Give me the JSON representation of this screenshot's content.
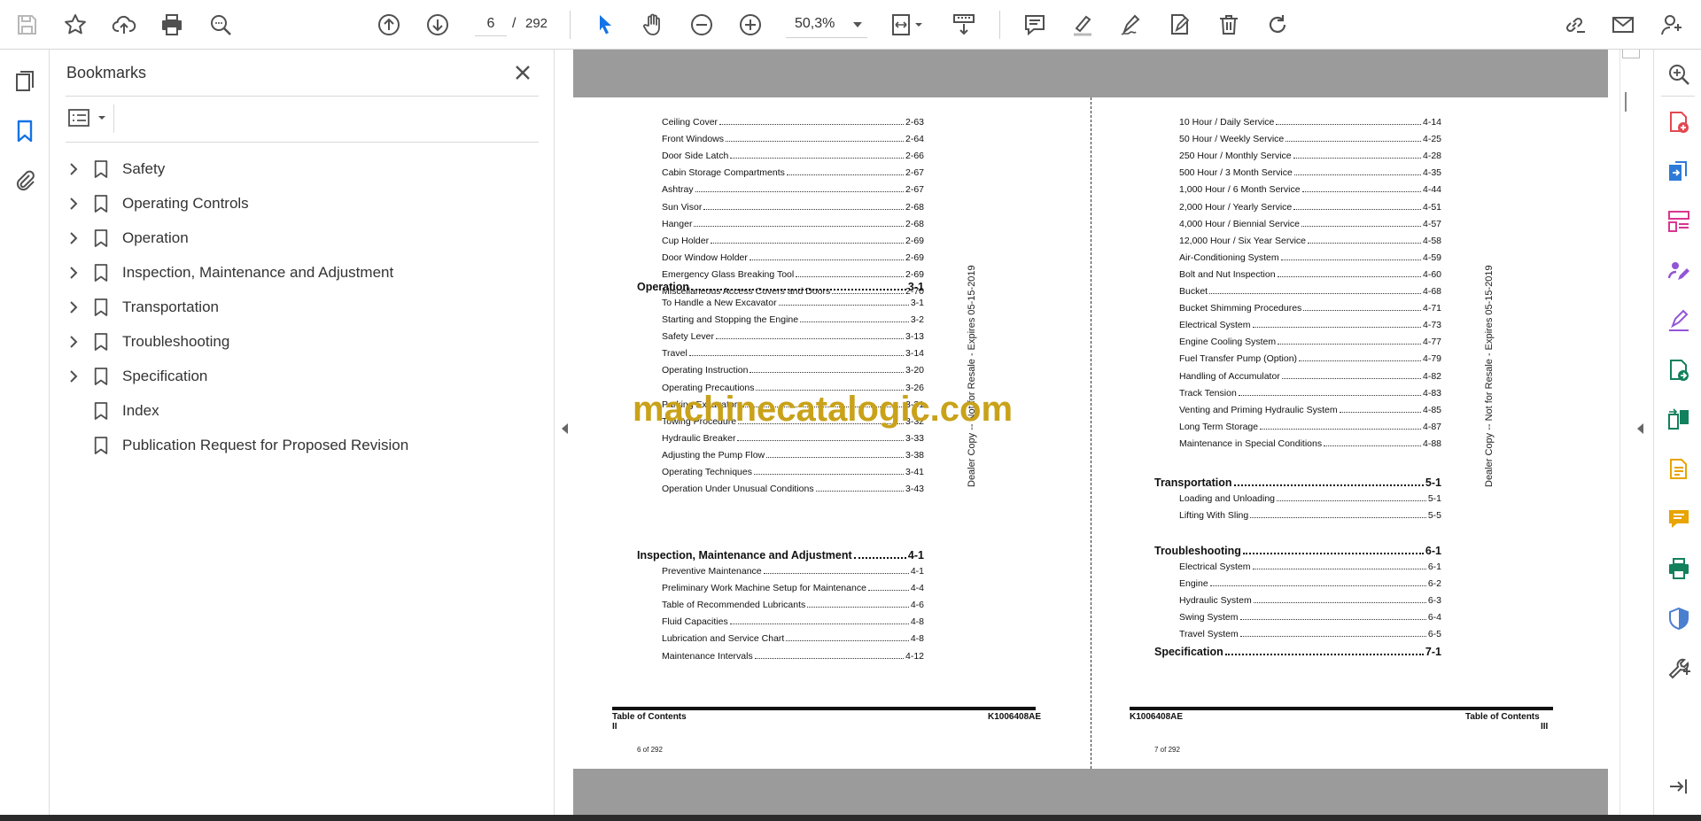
{
  "toolbar": {
    "current_page": "6",
    "page_separator": "/",
    "total_pages": "292",
    "zoom": "50,3%"
  },
  "bookmarks_panel": {
    "title": "Bookmarks",
    "items": [
      {
        "label": "Safety",
        "expandable": true
      },
      {
        "label": "Operating Controls",
        "expandable": true
      },
      {
        "label": "Operation",
        "expandable": true
      },
      {
        "label": "Inspection, Maintenance and Adjustment",
        "expandable": true
      },
      {
        "label": "Transportation",
        "expandable": true
      },
      {
        "label": "Troubleshooting",
        "expandable": true
      },
      {
        "label": "Specification",
        "expandable": true
      },
      {
        "label": "Index",
        "expandable": false
      },
      {
        "label": "Publication Request for Proposed Revision",
        "expandable": false
      }
    ]
  },
  "page_left": {
    "entries1": [
      {
        "t": "Ceiling Cover",
        "p": "2-63"
      },
      {
        "t": "Front Windows",
        "p": "2-64"
      },
      {
        "t": "Door Side Latch",
        "p": "2-66"
      },
      {
        "t": "Cabin Storage Compartments",
        "p": "2-67"
      },
      {
        "t": "Ashtray",
        "p": "2-67"
      },
      {
        "t": "Sun Visor",
        "p": "2-68"
      },
      {
        "t": "Hanger",
        "p": "2-68"
      },
      {
        "t": "Cup Holder",
        "p": "2-69"
      },
      {
        "t": "Door Window Holder",
        "p": "2-69"
      },
      {
        "t": "Emergency Glass Breaking Tool",
        "p": "2-69"
      },
      {
        "t": "Miscellaneous Access Covers and Doors",
        "p": "2-70"
      }
    ],
    "head_operation": {
      "t": "Operation",
      "p": "3-1"
    },
    "entries2": [
      {
        "t": "To Handle a New Excavator",
        "p": "3-1"
      },
      {
        "t": "Starting and Stopping the Engine",
        "p": "3-2"
      },
      {
        "t": "Safety Lever",
        "p": "3-13"
      },
      {
        "t": "Travel",
        "p": "3-14"
      },
      {
        "t": "Operating Instruction",
        "p": "3-20"
      },
      {
        "t": "Operating Precautions",
        "p": "3-26"
      },
      {
        "t": "Parking Excavator",
        "p": "3-31"
      },
      {
        "t": "Towing Procedure",
        "p": "3-32"
      },
      {
        "t": "Hydraulic Breaker",
        "p": "3-33"
      },
      {
        "t": "Adjusting the Pump Flow",
        "p": "3-38"
      },
      {
        "t": "Operating Techniques",
        "p": "3-41"
      },
      {
        "t": "Operation Under Unusual Conditions",
        "p": "3-43"
      }
    ],
    "head_inspection": {
      "t": "Inspection, Maintenance and Adjustment",
      "p": "4-1"
    },
    "entries3": [
      {
        "t": "Preventive Maintenance",
        "p": "4-1"
      },
      {
        "t": "Preliminary Work Machine Setup for Maintenance",
        "p": "4-4"
      },
      {
        "t": "Table of Recommended Lubricants",
        "p": "4-6"
      },
      {
        "t": "Fluid Capacities",
        "p": "4-8"
      },
      {
        "t": "Lubrication and Service Chart",
        "p": "4-8"
      },
      {
        "t": "Maintenance Intervals",
        "p": "4-12"
      }
    ],
    "footer_left": "Table of Contents",
    "footer_left_sub": "II",
    "footer_right": "K1006408AE",
    "page_of": "6 of 292",
    "stamp": "Dealer Copy -- Not for Resale - Expires 05-15-2019"
  },
  "page_right": {
    "entries1": [
      {
        "t": "10 Hour / Daily Service",
        "p": "4-14"
      },
      {
        "t": "50 Hour / Weekly Service",
        "p": "4-25"
      },
      {
        "t": "250 Hour / Monthly Service",
        "p": "4-28"
      },
      {
        "t": "500 Hour / 3 Month Service",
        "p": "4-35"
      },
      {
        "t": "1,000 Hour / 6 Month Service",
        "p": "4-44"
      },
      {
        "t": "2,000 Hour / Yearly Service",
        "p": "4-51"
      },
      {
        "t": "4,000 Hour / Biennial Service",
        "p": "4-57"
      },
      {
        "t": "12,000 Hour / Six Year Service",
        "p": "4-58"
      },
      {
        "t": "Air-Conditioning System",
        "p": "4-59"
      },
      {
        "t": "Bolt and Nut Inspection",
        "p": "4-60"
      },
      {
        "t": "Bucket",
        "p": "4-68"
      },
      {
        "t": "Bucket Shimming Procedures",
        "p": "4-71"
      },
      {
        "t": "Electrical System",
        "p": "4-73"
      },
      {
        "t": "Engine Cooling System",
        "p": "4-77"
      },
      {
        "t": "Fuel Transfer Pump (Option)",
        "p": "4-79"
      },
      {
        "t": "Handling of Accumulator",
        "p": "4-82"
      },
      {
        "t": "Track Tension",
        "p": "4-83"
      },
      {
        "t": "Venting and Priming Hydraulic System",
        "p": "4-85"
      },
      {
        "t": "Long Term Storage",
        "p": "4-87"
      },
      {
        "t": "Maintenance in Special Conditions",
        "p": "4-88"
      }
    ],
    "head_transportation": {
      "t": "Transportation",
      "p": "5-1"
    },
    "entries2": [
      {
        "t": "Loading and Unloading",
        "p": "5-1"
      },
      {
        "t": "Lifting With Sling",
        "p": "5-5"
      }
    ],
    "head_troubleshooting": {
      "t": "Troubleshooting",
      "p": "6-1"
    },
    "entries3": [
      {
        "t": "Electrical System",
        "p": "6-1"
      },
      {
        "t": "Engine",
        "p": "6-2"
      },
      {
        "t": "Hydraulic System",
        "p": "6-3"
      },
      {
        "t": "Swing System",
        "p": "6-4"
      },
      {
        "t": "Travel System",
        "p": "6-5"
      }
    ],
    "head_specification": {
      "t": "Specification",
      "p": "7-1"
    },
    "footer_left": "K1006408AE",
    "footer_right": "Table of Contents",
    "footer_right_sub": "III",
    "page_of": "7 of 292",
    "stamp": "Dealer Copy -- Not for Resale - Expires 05-15-2019"
  },
  "watermark": "machinecatalogic.com",
  "colors": {
    "accent_blue": "#1473e6",
    "icon_gray": "#505050",
    "watermark": "#c9a21a",
    "tool_red": "#e34850",
    "tool_blue": "#2d7bd8",
    "tool_pink": "#d83790",
    "tool_purple": "#9255d6",
    "tool_teal": "#12805c",
    "tool_yellow": "#e8a400",
    "tool_shield": "#4a7fcf"
  }
}
